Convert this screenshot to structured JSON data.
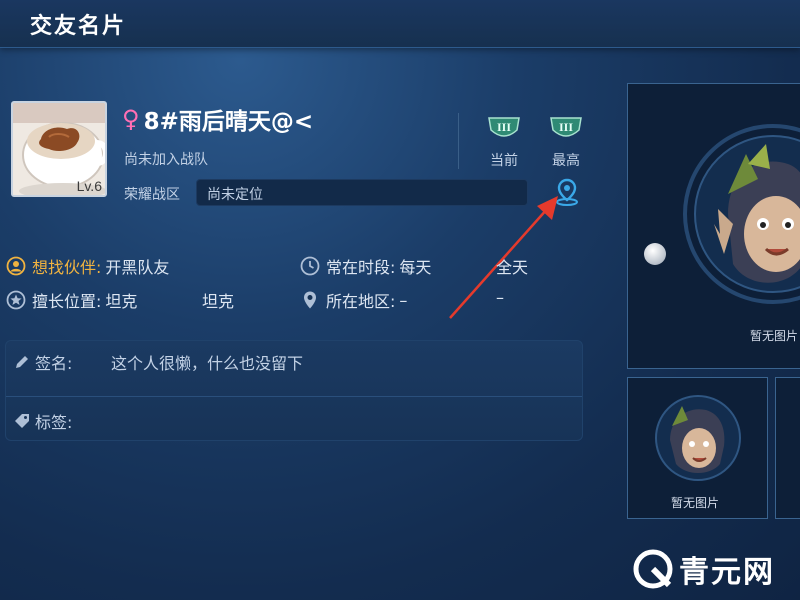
{
  "header": {
    "title": "交友名片"
  },
  "profile": {
    "gender_symbol": "♀",
    "name": "8#雨后晴天@<",
    "level": "Lv.6",
    "team_status": "尚未加入战队",
    "zone_label": "荣耀战区",
    "zone_value": "尚未定位"
  },
  "ranks": [
    {
      "label": "当前",
      "icon": "rank-badge-icon"
    },
    {
      "label": "最高",
      "icon": "rank-badge-icon"
    }
  ],
  "info": {
    "partner_label": "想找伙伴:",
    "partner_value": "开黑队友",
    "time_label": "常在时段:",
    "time_value": "每天",
    "time_value2": "全天",
    "position_label": "擅长位置:",
    "position_value": "坦克",
    "position_value2": "坦克",
    "region_label": "所在地区:",
    "region_value": "–",
    "region_value2": "–"
  },
  "signature": {
    "label": "签名:",
    "value": "这个人很懒，什么也没留下"
  },
  "tags": {
    "label": "标签:"
  },
  "photos": {
    "placeholder": "暂无图片"
  },
  "watermark": {
    "text": "青元网"
  },
  "colors": {
    "accent_yellow": "#f0b340",
    "female_pink": "#ff6fb4",
    "pin_blue": "#3aa8e8",
    "arrow_red": "#e53a2c"
  }
}
